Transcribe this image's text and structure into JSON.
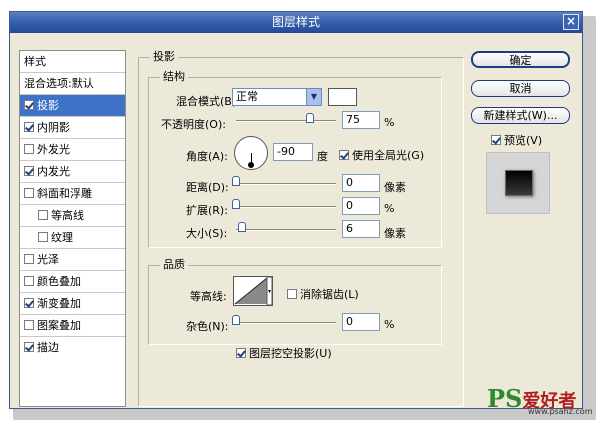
{
  "window": {
    "title": "图层样式",
    "close_label": "×"
  },
  "styles_list": {
    "header": "样式",
    "blend_options": "混合选项:默认",
    "items": [
      {
        "label": "投影",
        "checked": true,
        "selected": true
      },
      {
        "label": "内阴影",
        "checked": true
      },
      {
        "label": "外发光",
        "checked": false
      },
      {
        "label": "内发光",
        "checked": true
      },
      {
        "label": "斜面和浮雕",
        "checked": false
      },
      {
        "label": "等高线",
        "checked": false
      },
      {
        "label": "纹理",
        "checked": false
      },
      {
        "label": "光泽",
        "checked": false
      },
      {
        "label": "颜色叠加",
        "checked": false
      },
      {
        "label": "渐变叠加",
        "checked": true
      },
      {
        "label": "图案叠加",
        "checked": false
      },
      {
        "label": "描边",
        "checked": true
      }
    ]
  },
  "drop_shadow": {
    "section_title": "投影",
    "structure": {
      "title": "结构",
      "blend_mode_label": "混合模式(B):",
      "blend_mode_value": "正常",
      "opacity_label": "不透明度(O):",
      "opacity_value": "75",
      "opacity_unit": "%",
      "angle_label": "角度(A):",
      "angle_value": "-90",
      "angle_unit": "度",
      "global_light_label": "使用全局光(G)",
      "global_light_checked": true,
      "distance_label": "距离(D):",
      "distance_value": "0",
      "distance_unit": "像素",
      "spread_label": "扩展(R):",
      "spread_value": "0",
      "spread_unit": "%",
      "size_label": "大小(S):",
      "size_value": "6",
      "size_unit": "像素"
    },
    "quality": {
      "title": "品质",
      "contour_label": "等高线:",
      "antialias_label": "消除锯齿(L)",
      "antialias_checked": false,
      "noise_label": "杂色(N):",
      "noise_value": "0",
      "noise_unit": "%"
    },
    "knockout_label": "图层挖空投影(U)",
    "knockout_checked": true
  },
  "buttons": {
    "ok": "确定",
    "cancel": "取消",
    "new_style": "新建样式(W)...",
    "preview_label": "预览(V)",
    "preview_checked": true
  },
  "watermark": {
    "ps": "PS",
    "name": "爱好者",
    "url": "www.psahz.com"
  }
}
